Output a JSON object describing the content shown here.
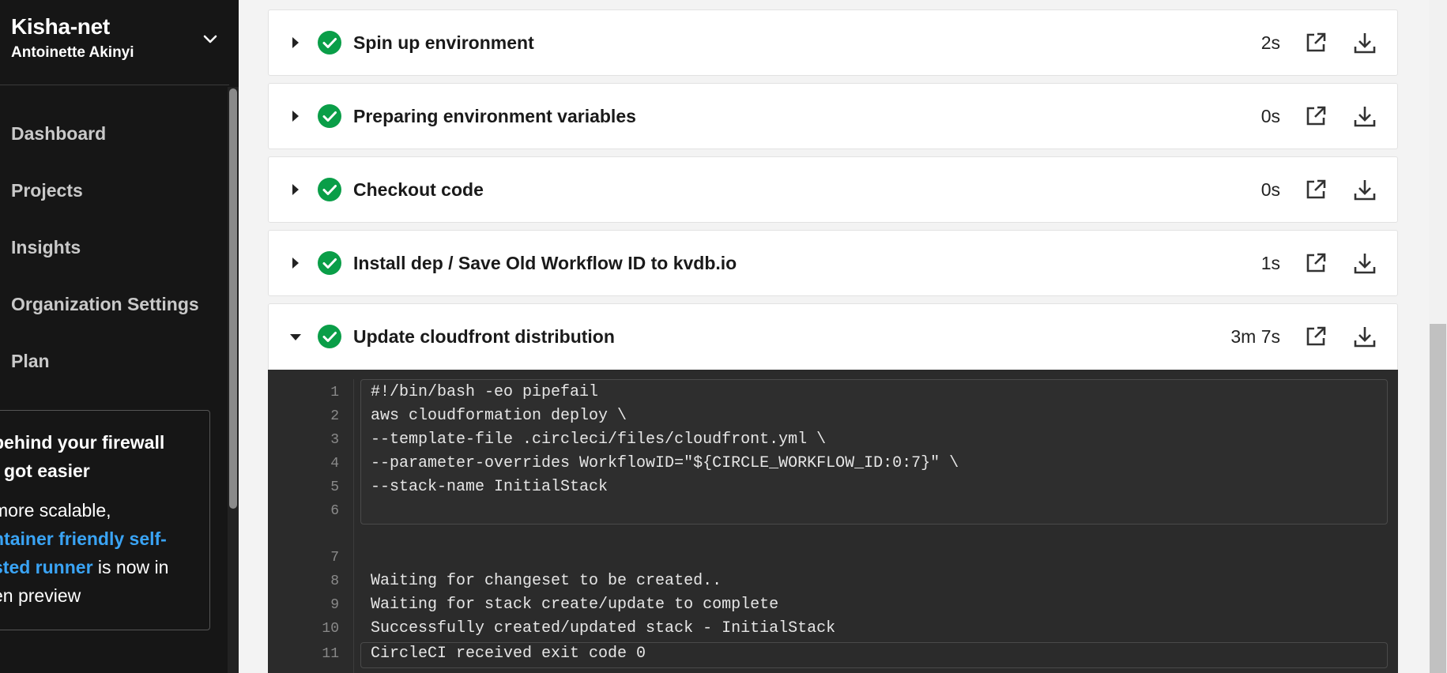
{
  "sidebar": {
    "org_name": "Kisha-net",
    "user_name": "Antoinette Akinyi",
    "nav": [
      "Dashboard",
      "Projects",
      "Insights",
      "Organization Settings",
      "Plan"
    ],
    "promo": {
      "title_line1": "behind your firewall",
      "title_line2": "t got easier",
      "body_line1": "more scalable,",
      "link_line1": "ntainer friendly self-",
      "link_line2": "sted runner",
      "body_line3_rest": " is now in",
      "body_line4": "en preview"
    }
  },
  "steps": [
    {
      "title": "Spin up environment",
      "duration": "2s",
      "expanded": false
    },
    {
      "title": "Preparing environment variables",
      "duration": "0s",
      "expanded": false
    },
    {
      "title": "Checkout code",
      "duration": "0s",
      "expanded": false
    },
    {
      "title": "Install dep / Save Old Workflow ID to kvdb.io",
      "duration": "1s",
      "expanded": false
    },
    {
      "title": "Update cloudfront distribution",
      "duration": "3m 7s",
      "expanded": true
    }
  ],
  "terminal": {
    "lines": [
      {
        "n": "1",
        "text": "#!/bin/bash -eo pipefail"
      },
      {
        "n": "2",
        "text": "aws cloudformation deploy \\"
      },
      {
        "n": "3",
        "text": "--template-file .circleci/files/cloudfront.yml \\"
      },
      {
        "n": "4",
        "text": "--parameter-overrides WorkflowID=\"${CIRCLE_WORKFLOW_ID:0:7}\" \\"
      },
      {
        "n": "5",
        "text": "--stack-name InitialStack"
      },
      {
        "n": "6",
        "text": ""
      },
      {
        "n": "7",
        "text": ""
      },
      {
        "n": "8",
        "text": "Waiting for changeset to be created.."
      },
      {
        "n": "9",
        "text": "Waiting for stack create/update to complete"
      },
      {
        "n": "10",
        "text": "Successfully created/updated stack - InitialStack"
      },
      {
        "n": "11",
        "text": "CircleCI received exit code 0"
      }
    ]
  },
  "colors": {
    "success": "#0a9e48",
    "sidebar_bg": "#161616",
    "link": "#3aa4f5",
    "terminal_bg": "#2b2b2b"
  }
}
